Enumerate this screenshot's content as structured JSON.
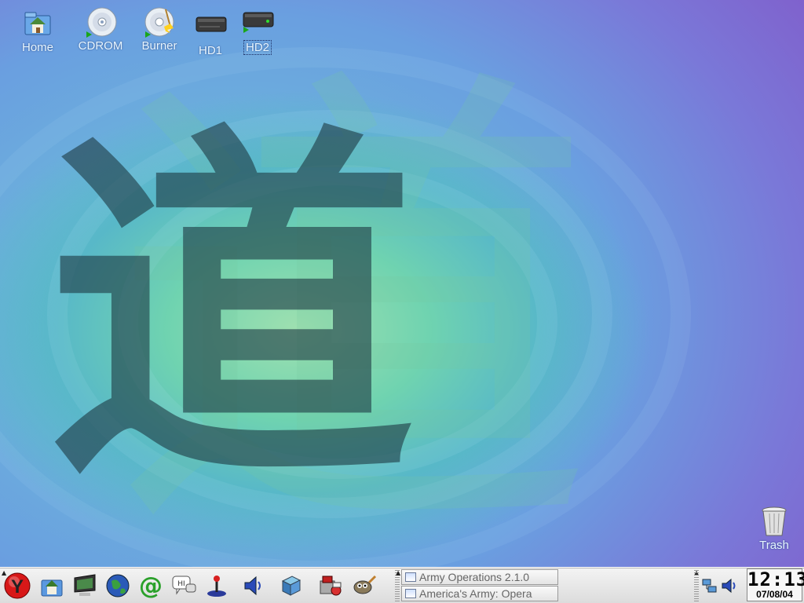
{
  "desktop": {
    "icons": [
      {
        "label": "Home",
        "icon": "home-folder-icon"
      },
      {
        "label": "CDROM",
        "icon": "cdrom-icon"
      },
      {
        "label": "Burner",
        "icon": "cd-burner-icon"
      },
      {
        "label": "HD1",
        "icon": "hard-drive-icon"
      },
      {
        "label": "HD2",
        "icon": "hard-drive-icon"
      }
    ],
    "trash": {
      "label": "Trash",
      "icon": "trash-icon"
    },
    "wallpaper_glyph": "道"
  },
  "taskbar": {
    "launchers": [
      {
        "name": "menu-button",
        "icon": "y-menu-icon"
      },
      {
        "name": "home-launcher",
        "icon": "home-icon"
      },
      {
        "name": "terminal-launcher",
        "icon": "monitor-icon"
      },
      {
        "name": "browser-launcher",
        "icon": "globe-icon"
      },
      {
        "name": "mail-launcher",
        "icon": "at-sign-icon"
      },
      {
        "name": "chat-launcher",
        "icon": "chat-bubble-icon"
      },
      {
        "name": "joystick-launcher",
        "icon": "joystick-icon"
      },
      {
        "name": "audio-launcher",
        "icon": "speaker-icon"
      },
      {
        "name": "server-launcher",
        "icon": "server-box-icon"
      },
      {
        "name": "software-launcher",
        "icon": "package-icon"
      },
      {
        "name": "gimp-launcher",
        "icon": "gimp-icon"
      }
    ],
    "tasks": [
      {
        "label": "Army Operations 2.1.0"
      },
      {
        "label": "America's Army: Opera"
      }
    ],
    "tray": [
      {
        "icon": "network-icon"
      },
      {
        "icon": "volume-icon"
      }
    ],
    "clock": {
      "time": "12:13",
      "date": "07/08/04"
    }
  },
  "colors": {
    "taskbar_bg": "#e6e6e6",
    "label_text": "#e8f6ff",
    "menu_red": "#d81818"
  }
}
